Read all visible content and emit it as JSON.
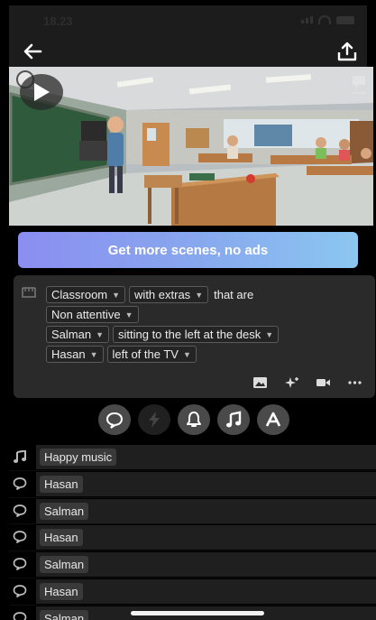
{
  "status_bar": {
    "time": "18.23"
  },
  "cta": {
    "label": "Get more scenes, no ads"
  },
  "description": {
    "line1": {
      "location": "Classroom",
      "extras": "with extras",
      "connector": "that are"
    },
    "line2": {
      "attitude": "Non attentive"
    },
    "line3": {
      "character": "Salman",
      "position": "sitting to the left at the desk"
    },
    "line4": {
      "character": "Hasan",
      "position": "left of the TV"
    }
  },
  "categories": [
    {
      "icon": "speech-bubble-icon",
      "active": true
    },
    {
      "icon": "lightning-icon",
      "active": false
    },
    {
      "icon": "bell-icon",
      "active": true
    },
    {
      "icon": "music-note-icon",
      "active": true
    },
    {
      "icon": "text-a-icon",
      "active": true
    }
  ],
  "timeline": [
    {
      "type": "music",
      "icon": "music-note-icon",
      "label": "Happy music"
    },
    {
      "type": "dialogue",
      "icon": "speech-bubble-icon",
      "label": "Hasan"
    },
    {
      "type": "dialogue",
      "icon": "speech-bubble-icon",
      "label": "Salman"
    },
    {
      "type": "dialogue",
      "icon": "speech-bubble-icon",
      "label": "Hasan"
    },
    {
      "type": "dialogue",
      "icon": "speech-bubble-icon",
      "label": "Salman"
    },
    {
      "type": "dialogue",
      "icon": "speech-bubble-icon",
      "label": "Hasan"
    },
    {
      "type": "dialogue",
      "icon": "speech-bubble-icon",
      "label": "Salman"
    }
  ],
  "colors": {
    "cta_start": "#8a8ef0",
    "cta_end": "#8bc7f0",
    "card_bg": "#2a2a2a",
    "background": "#000000"
  }
}
